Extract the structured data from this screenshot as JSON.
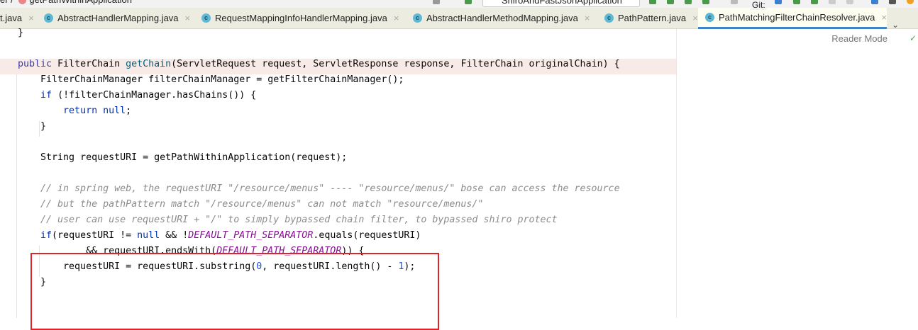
{
  "breadcrumb": {
    "method": "getPathWithinApplication"
  },
  "toolbar": {
    "run_config": "ShiroAndFastJsonApplication",
    "git_label": "Git:"
  },
  "tabs": [
    {
      "label": "t.java",
      "active": false
    },
    {
      "label": "AbstractHandlerMapping.java",
      "active": false
    },
    {
      "label": "RequestMappingInfoHandlerMapping.java",
      "active": false
    },
    {
      "label": "AbstractHandlerMethodMapping.java",
      "active": false
    },
    {
      "label": "PathPattern.java",
      "active": false
    },
    {
      "label": "PathMatchingFilterChainResolver.java",
      "active": true
    }
  ],
  "tab_close": "×",
  "tab_more": "⌄",
  "reader_mode": "Reader Mode",
  "reader_check": "✓",
  "code": [
    [
      [
        "}",
        ""
      ]
    ],
    [],
    [
      [
        "public ",
        "kw2"
      ],
      [
        "FilterChain ",
        ""
      ],
      [
        "getChain",
        "fn"
      ],
      [
        "(ServletRequest request, ServletResponse response, FilterChain originalChain) {",
        ""
      ]
    ],
    [
      [
        "    FilterChainManager filterChainManager = getFilterChainManager();",
        ""
      ]
    ],
    [
      [
        "    ",
        ""
      ],
      [
        "if ",
        "kw"
      ],
      [
        "(!filterChainManager.hasChains()) {",
        ""
      ]
    ],
    [
      [
        "        ",
        ""
      ],
      [
        "return null",
        "kw"
      ],
      [
        ";",
        ""
      ]
    ],
    [
      [
        "    }",
        ""
      ]
    ],
    [],
    [
      [
        "    String requestURI = getPathWithinApplication(request);",
        ""
      ]
    ],
    [],
    [
      [
        "    // in spring web, the requestURI \"/resource/menus\" ---- \"resource/menus/\" bose can access the resource",
        "cm"
      ]
    ],
    [
      [
        "    // but the pathPattern match \"/resource/menus\" can not match \"resource/menus/\"",
        "cm"
      ]
    ],
    [
      [
        "    // user can use requestURI + \"/\" to simply bypassed chain filter, to bypassed shiro protect",
        "cm"
      ]
    ],
    [
      [
        "    ",
        ""
      ],
      [
        "if",
        "kw"
      ],
      [
        "(requestURI != ",
        ""
      ],
      [
        "null",
        "kw"
      ],
      [
        " && !",
        ""
      ],
      [
        "DEFAULT_PATH_SEPARATOR",
        "cst"
      ],
      [
        ".equals(requestURI)",
        ""
      ]
    ],
    [
      [
        "            && requestURI.endsWith(",
        ""
      ],
      [
        "DEFAULT_PATH_SEPARATOR",
        "cst"
      ],
      [
        ")) {",
        ""
      ]
    ],
    [
      [
        "        requestURI = requestURI.substring(",
        ""
      ],
      [
        "0",
        "num"
      ],
      [
        ", requestURI.length() - ",
        ""
      ],
      [
        "1",
        "num"
      ],
      [
        ");",
        ""
      ]
    ],
    [
      [
        "    }",
        ""
      ]
    ]
  ]
}
